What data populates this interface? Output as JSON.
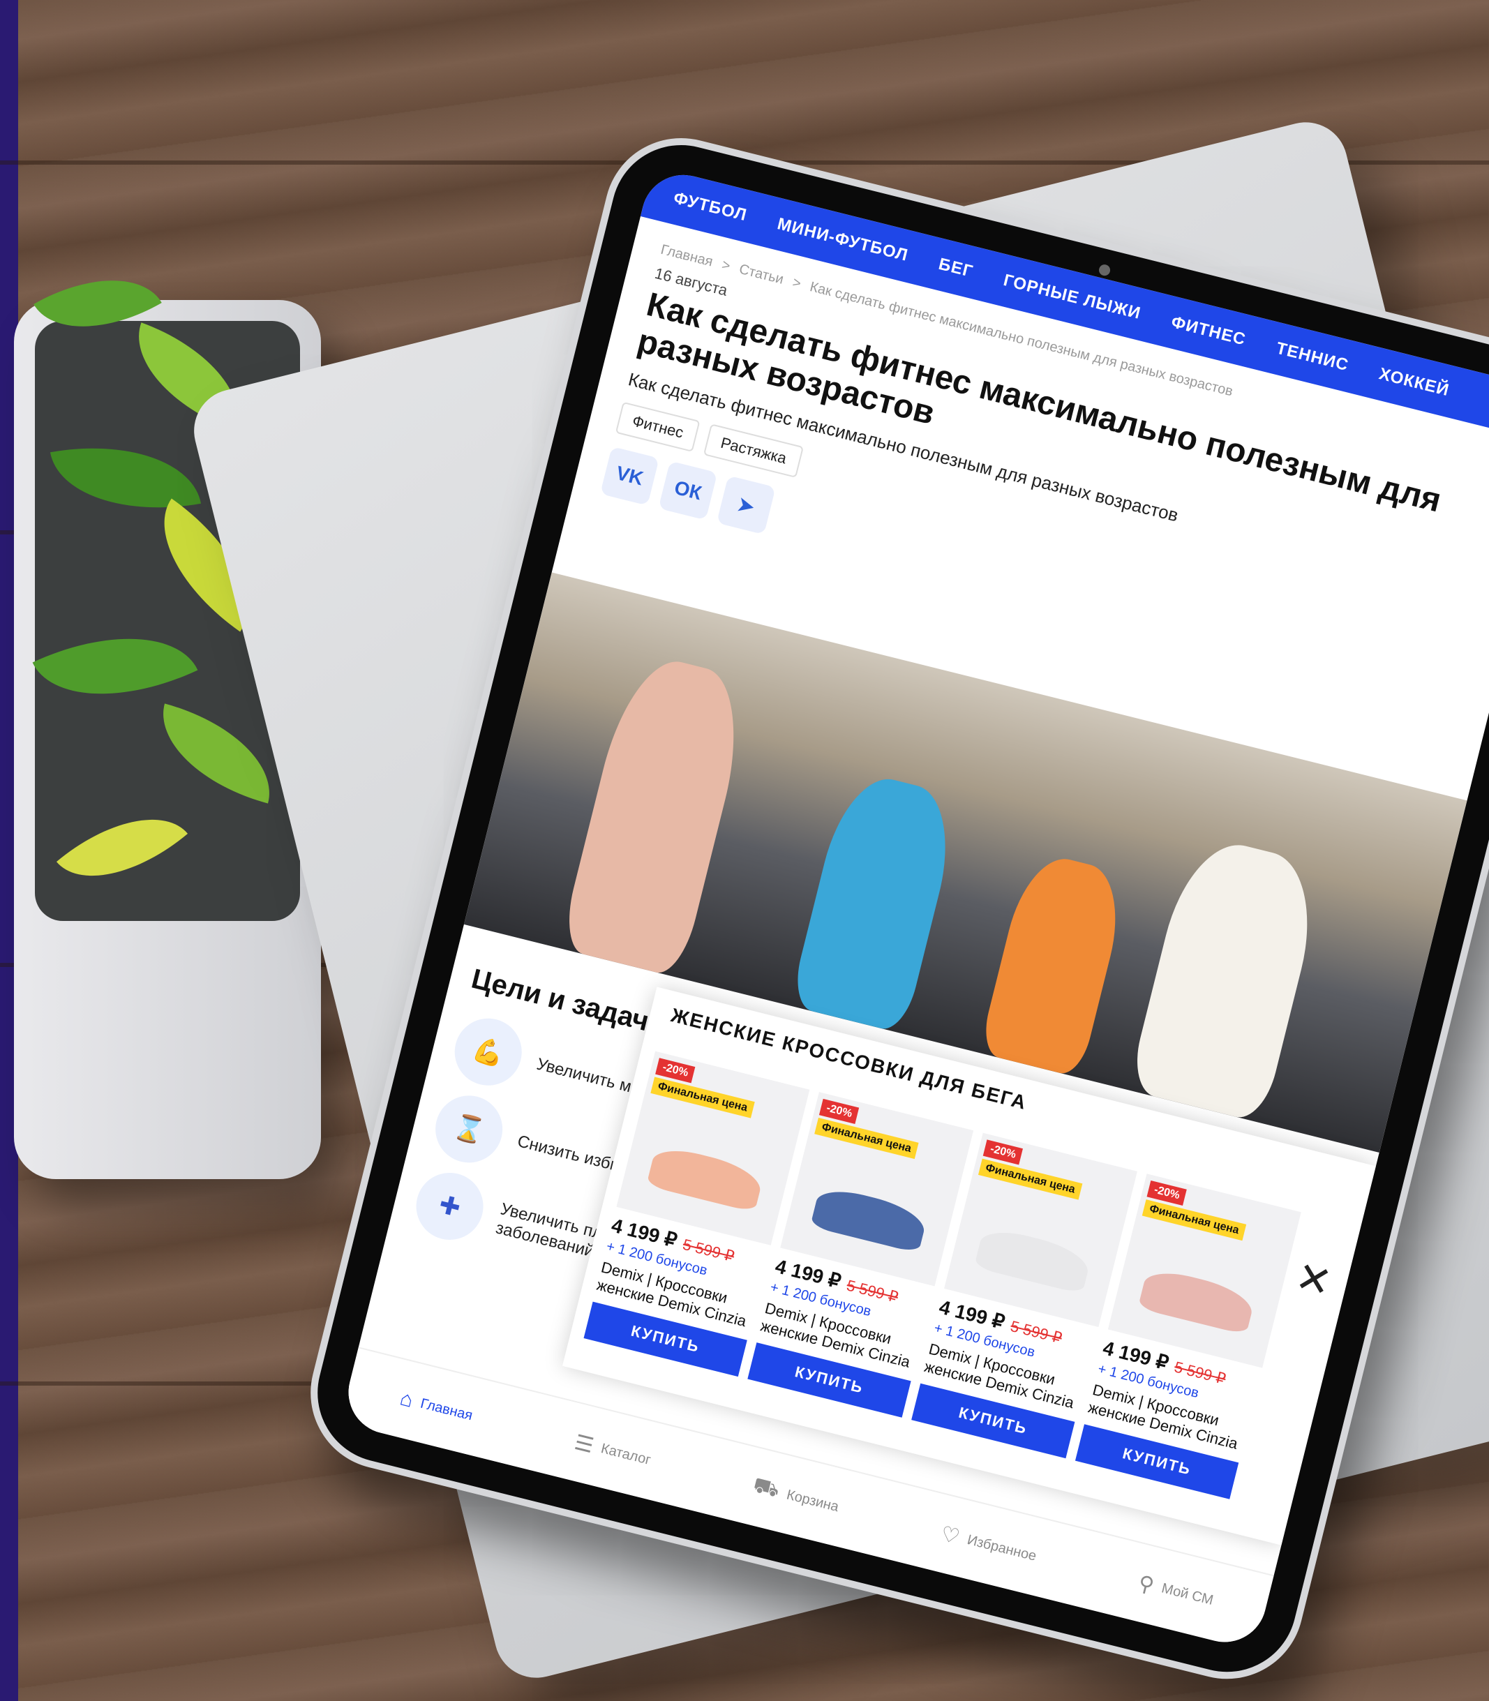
{
  "nav": {
    "items": [
      "ФУТБОЛ",
      "МИНИ-ФУТБОЛ",
      "БЕГ",
      "ГОРНЫЕ ЛЫЖИ",
      "ФИТНЕС",
      "ТЕННИС",
      "ХОККЕЙ"
    ]
  },
  "breadcrumb": {
    "items": [
      "Главная",
      "Статьи",
      "Как сделать фитнес максимально полезным для разных возрастов"
    ],
    "separator": ">"
  },
  "article": {
    "date": "16 августа",
    "title": "Как сделать фитнес максимально полезным для разных возрастов",
    "subtitle": "Как сделать фитнес максимально полезным для разных возрастов",
    "tags": [
      "Фитнес",
      "Растяжка"
    ]
  },
  "share": {
    "vk_label": "VK",
    "ok_label": "ОК",
    "tg_label": "➤"
  },
  "goals": {
    "heading": "Цели и задачи",
    "items": [
      "Увеличить мы",
      "Снизить избы",
      "Увеличить пл заболеваний"
    ]
  },
  "promo": {
    "title": "ЖЕНСКИЕ КРОССОВКИ ДЛЯ БЕГА",
    "close_label": "✕",
    "products": [
      {
        "discount": "-20%",
        "badge": "Финальная цена",
        "price": "4 199 ₽",
        "old_price": "5 599 ₽",
        "bonus": "+ 1 200 бонусов",
        "name": "Demix | Кроссовки женские Demix Cinzia",
        "buy": "КУПИТЬ",
        "shoe_color": "#f2b59a"
      },
      {
        "discount": "-20%",
        "badge": "Финальная цена",
        "price": "4 199 ₽",
        "old_price": "5 599 ₽",
        "bonus": "+ 1 200 бонусов",
        "name": "Demix | Кроссовки женские Demix Cinzia",
        "buy": "КУПИТЬ",
        "shoe_color": "#4b6aa8"
      },
      {
        "discount": "-20%",
        "badge": "Финальная цена",
        "price": "4 199 ₽",
        "old_price": "5 599 ₽",
        "bonus": "+ 1 200 бонусов",
        "name": "Demix | Кроссовки женские Demix Cinzia",
        "buy": "КУПИТЬ",
        "shoe_color": "#e8e8ea"
      },
      {
        "discount": "-20%",
        "badge": "Финальная цена",
        "price": "4 199 ₽",
        "old_price": "5 599 ₽",
        "bonus": "+ 1 200 бонусов",
        "name": "Demix | Кроссовки женские Demix Cinzia",
        "buy": "КУПИТЬ",
        "shoe_color": "#e8b7b0"
      }
    ]
  },
  "tabbar": {
    "items": [
      "Главная",
      "Каталог",
      "Корзина",
      "Избранное",
      "Мой СМ"
    ]
  },
  "colors": {
    "brand": "#1f47e8",
    "discount": "#e43232",
    "badge": "#ffd42a",
    "side_stripe": "#2a1a72"
  }
}
